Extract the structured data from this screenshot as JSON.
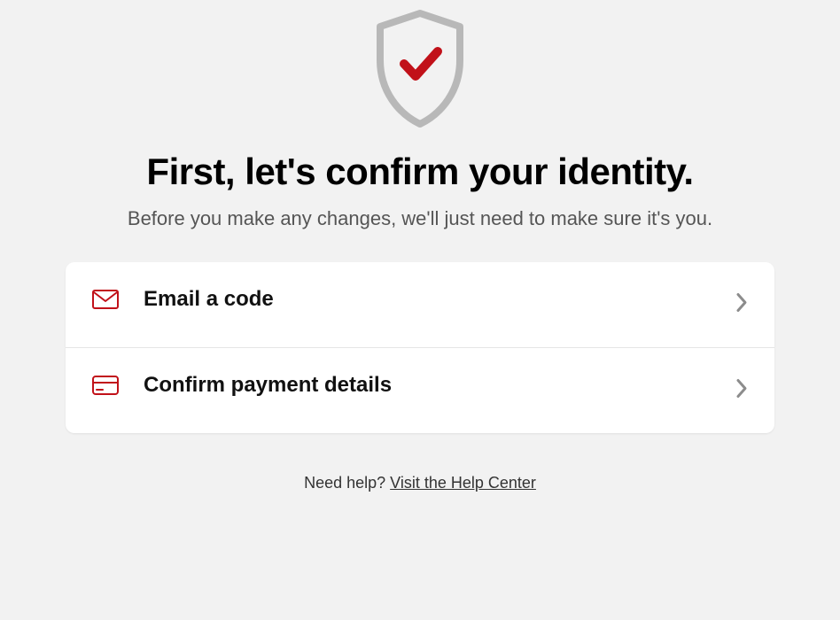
{
  "icons": {
    "shield": "shield-check-icon",
    "email": "envelope-icon",
    "payment": "credit-card-icon",
    "chevron": "chevron-right-icon"
  },
  "colors": {
    "accent": "#c11119",
    "shield_stroke": "#b8b8b8",
    "chevron": "#8c8c8c"
  },
  "heading": "First, let's confirm your identity.",
  "subheading": "Before you make any changes, we'll just need to make sure it's you.",
  "options": [
    {
      "id": "email",
      "label": "Email a code"
    },
    {
      "id": "payment",
      "label": "Confirm payment details"
    }
  ],
  "footer": {
    "prompt": "Need help? ",
    "link_text": "Visit the Help Center"
  }
}
